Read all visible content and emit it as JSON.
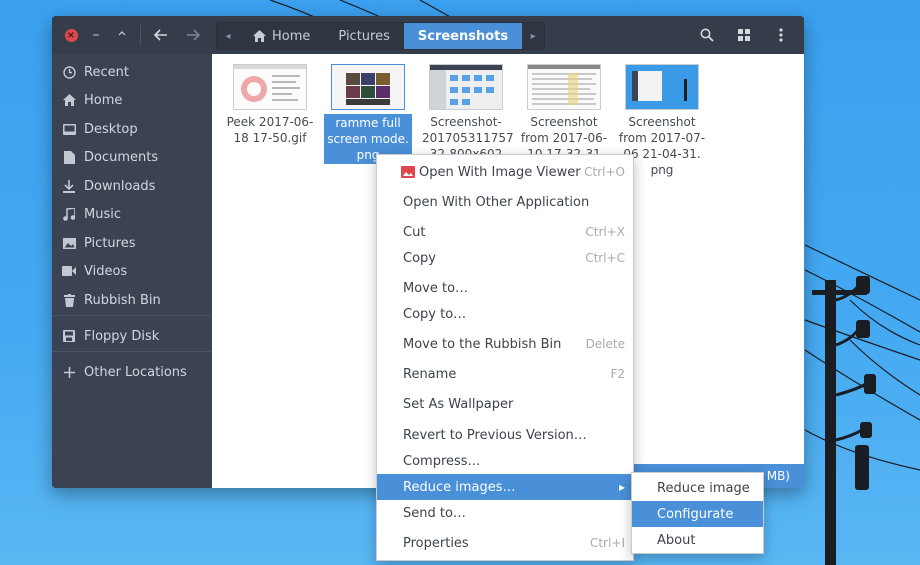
{
  "window": {
    "pathbar": {
      "crumbs": [
        "Home",
        "Pictures",
        "Screenshots"
      ]
    }
  },
  "sidebar": {
    "items": [
      {
        "label": "Recent",
        "icon": "clock-icon"
      },
      {
        "label": "Home",
        "icon": "home-icon"
      },
      {
        "label": "Desktop",
        "icon": "desktop-icon"
      },
      {
        "label": "Documents",
        "icon": "document-icon"
      },
      {
        "label": "Downloads",
        "icon": "download-icon"
      },
      {
        "label": "Music",
        "icon": "music-icon"
      },
      {
        "label": "Pictures",
        "icon": "picture-icon"
      },
      {
        "label": "Videos",
        "icon": "video-icon"
      },
      {
        "label": "Rubbish Bin",
        "icon": "trash-icon"
      }
    ],
    "devices": [
      {
        "label": "Floppy Disk",
        "icon": "floppy-icon"
      }
    ],
    "other": {
      "label": "Other Locations",
      "icon": "plus-icon"
    }
  },
  "files": [
    {
      "lines": [
        "Peek 2017-06-",
        "18 17-50.gif"
      ]
    },
    {
      "lines": [
        "ramme full",
        "screen mode.",
        "png"
      ],
      "selected": true
    },
    {
      "lines": [
        "Screenshot-",
        "201705311757",
        "32-800x602"
      ]
    },
    {
      "lines": [
        "Screenshot",
        "from 2017-06-",
        "10 17-32-31"
      ]
    },
    {
      "lines": [
        "Screenshot",
        "from 2017-07-",
        "06 21-04-31.",
        "png"
      ]
    }
  ],
  "statusbar": {
    "text": "MB)"
  },
  "context_menu": {
    "items": [
      {
        "label": "Open With Image Viewer",
        "accel": "Ctrl+O"
      },
      {
        "label": "Open With Other Application",
        "accel": ""
      },
      {
        "label": "Cut",
        "accel": "Ctrl+X"
      },
      {
        "label": "Copy",
        "accel": "Ctrl+C"
      },
      {
        "label": "Move to…",
        "accel": ""
      },
      {
        "label": "Copy to…",
        "accel": ""
      },
      {
        "label": "Move to the Rubbish Bin",
        "accel": "Delete"
      },
      {
        "label": "Rename",
        "accel": "F2"
      },
      {
        "label": "Set As Wallpaper",
        "accel": ""
      },
      {
        "label": "Revert to Previous Version…",
        "accel": ""
      },
      {
        "label": "Compress…",
        "accel": ""
      },
      {
        "label": "Reduce images…",
        "accel": "▸"
      },
      {
        "label": "Send to…",
        "accel": ""
      },
      {
        "label": "Properties",
        "accel": "Ctrl+I"
      }
    ]
  },
  "submenu": {
    "items": [
      "Reduce image",
      "Configurate",
      "About"
    ]
  },
  "colors": {
    "accent": "#4a90d9",
    "close": "#e0474c",
    "sidebar_bg": "#3b4352",
    "headerbar_bg": "#353d4a",
    "desktop_sky": "#3aa0ef"
  }
}
